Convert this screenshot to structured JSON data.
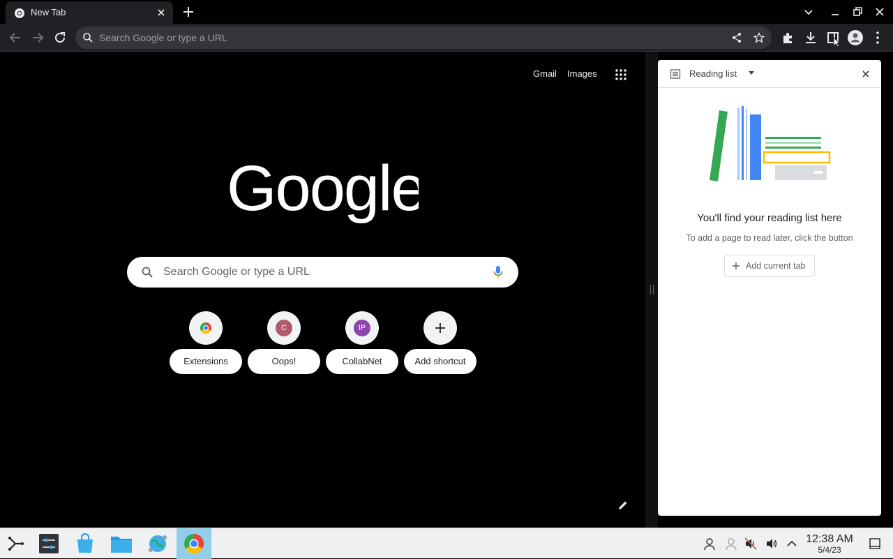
{
  "browser": {
    "tab": {
      "title": "New Tab"
    },
    "omnibox": {
      "placeholder": "Search Google or type a URL"
    }
  },
  "ntp": {
    "links": {
      "gmail": "Gmail",
      "images": "Images"
    },
    "search": {
      "placeholder": "Search Google or type a URL"
    },
    "shortcuts": [
      {
        "label": "Extensions",
        "initial": "",
        "color": ""
      },
      {
        "label": "Oops!",
        "initial": "C",
        "color": "#b05a6a"
      },
      {
        "label": "CollabNet",
        "initial": "IP",
        "color": "#8e44ad"
      },
      {
        "label": "Add shortcut",
        "initial": "",
        "color": ""
      }
    ]
  },
  "side_panel": {
    "title": "Reading list",
    "heading": "You'll find your reading list here",
    "subtext": "To add a page to read later, click the button",
    "add_button": "Add current tab"
  },
  "taskbar": {
    "time": "12:38 AM",
    "date": "5/4/23",
    "active_color": "#93cee9"
  },
  "icons": [
    "chrome-icon",
    "close-icon",
    "plus-icon",
    "chevron-down-icon",
    "minimize-icon",
    "maximize-icon",
    "back-icon",
    "forward-icon",
    "reload-icon",
    "search-icon",
    "share-icon",
    "star-icon",
    "puzzle-icon",
    "download-icon",
    "reading-list-icon",
    "profile-icon",
    "more-icon",
    "apps-grid-icon",
    "mic-icon",
    "pencil-icon"
  ]
}
